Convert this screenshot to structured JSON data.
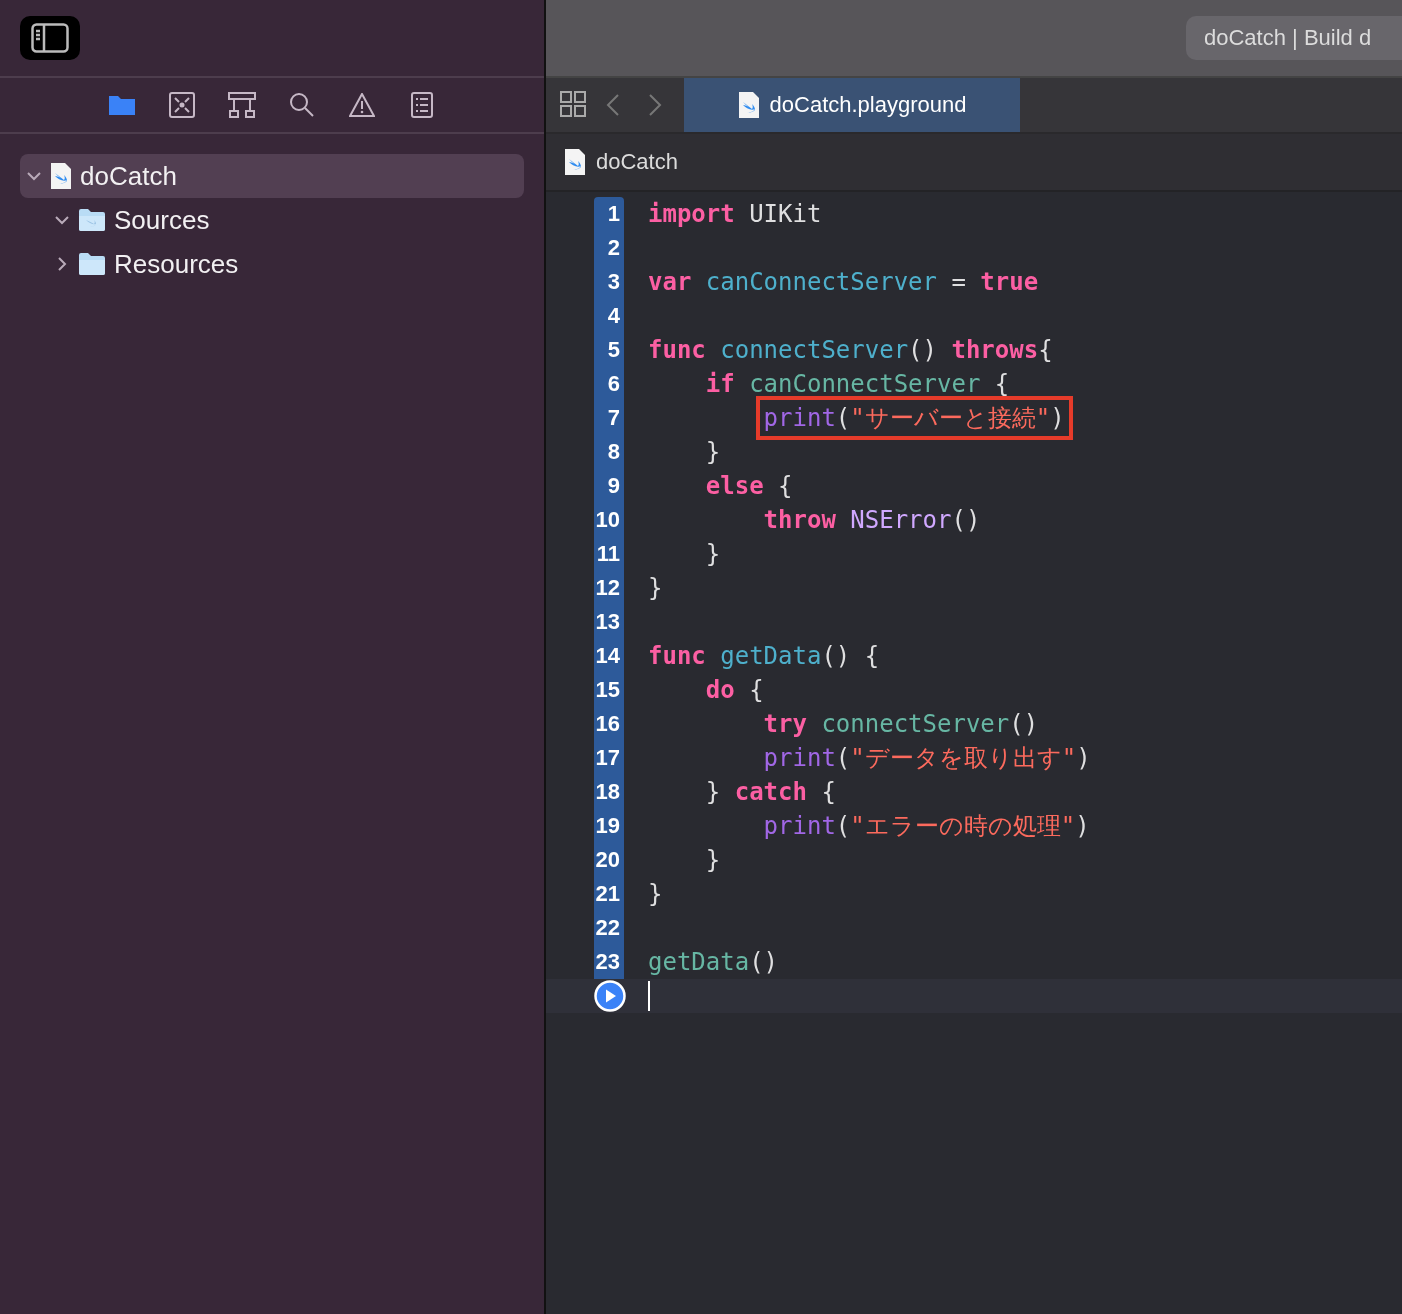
{
  "sidebar": {
    "navigator_tabs": [
      {
        "kind": "folder",
        "selected": true
      },
      {
        "kind": "source-control",
        "selected": false
      },
      {
        "kind": "hierarchy",
        "selected": false
      },
      {
        "kind": "search",
        "selected": false
      },
      {
        "kind": "warning",
        "selected": false
      },
      {
        "kind": "report",
        "selected": false
      }
    ],
    "tree": [
      {
        "label": "doCatch",
        "kind": "playground",
        "selected": true,
        "expanded": true,
        "children": [
          {
            "label": "Sources",
            "kind": "swift-folder",
            "selected": false,
            "expanded": true
          },
          {
            "label": "Resources",
            "kind": "folder",
            "selected": false,
            "expanded": false
          }
        ]
      }
    ]
  },
  "toolbar": {
    "activity_view": "doCatch | Build d"
  },
  "editor": {
    "tabs": [
      {
        "label": "doCatch.playground",
        "selected": true
      }
    ],
    "breadcrumb": [
      "doCatch"
    ],
    "lines": [
      {
        "number": "1",
        "tokens": [
          {
            "kind": "kw",
            "text": "import"
          },
          {
            "kind": "plain",
            "text": " UIKit"
          }
        ]
      },
      {
        "number": "2"
      },
      {
        "number": "3",
        "tokens": [
          {
            "kind": "kw",
            "text": "var"
          },
          {
            "kind": "decl",
            "text": " canConnectServer"
          },
          {
            "kind": "plain",
            "text": " = "
          },
          {
            "kind": "kw",
            "text": "true"
          }
        ]
      },
      {
        "number": "4"
      },
      {
        "number": "5",
        "tokens": [
          {
            "kind": "kw",
            "text": "func"
          },
          {
            "kind": "decl",
            "text": " connectServer"
          },
          {
            "kind": "plain",
            "text": "() "
          },
          {
            "kind": "kw",
            "text": "throws"
          },
          {
            "kind": "plain",
            "text": "{"
          }
        ]
      },
      {
        "number": "6",
        "tokens": [
          {
            "kind": "kw",
            "text": "    if"
          },
          {
            "kind": "ref",
            "text": " canConnectServer"
          },
          {
            "kind": "plain",
            "text": " {"
          }
        ]
      },
      {
        "number": "7",
        "highlighted": true,
        "tokens": [
          {
            "kind": "builtin",
            "text": "        print"
          },
          {
            "kind": "plain",
            "text": "("
          },
          {
            "kind": "str",
            "text": "\"サーバーと接続\""
          },
          {
            "kind": "plain",
            "text": ")"
          }
        ]
      },
      {
        "number": "8",
        "tokens": [
          {
            "kind": "plain",
            "text": "    }"
          }
        ]
      },
      {
        "number": "9",
        "tokens": [
          {
            "kind": "kw",
            "text": "    else"
          },
          {
            "kind": "plain",
            "text": " {"
          }
        ]
      },
      {
        "number": "10",
        "tokens": [
          {
            "kind": "kw",
            "text": "        throw"
          },
          {
            "kind": "type",
            "text": " NSError"
          },
          {
            "kind": "plain",
            "text": "()"
          }
        ]
      },
      {
        "number": "11",
        "tokens": [
          {
            "kind": "plain",
            "text": "    }"
          }
        ]
      },
      {
        "number": "12",
        "tokens": [
          {
            "kind": "plain",
            "text": "}"
          }
        ]
      },
      {
        "number": "13"
      },
      {
        "number": "14",
        "tokens": [
          {
            "kind": "kw",
            "text": "func"
          },
          {
            "kind": "decl",
            "text": " getData"
          },
          {
            "kind": "plain",
            "text": "() {"
          }
        ]
      },
      {
        "number": "15",
        "tokens": [
          {
            "kind": "kw",
            "text": "    do"
          },
          {
            "kind": "plain",
            "text": " {"
          }
        ]
      },
      {
        "number": "16",
        "tokens": [
          {
            "kind": "kw",
            "text": "        try"
          },
          {
            "kind": "ref",
            "text": " connectServer"
          },
          {
            "kind": "plain",
            "text": "()"
          }
        ]
      },
      {
        "number": "17",
        "tokens": [
          {
            "kind": "builtin",
            "text": "        print"
          },
          {
            "kind": "plain",
            "text": "("
          },
          {
            "kind": "str",
            "text": "\"データを取り出す\""
          },
          {
            "kind": "plain",
            "text": ")"
          }
        ]
      },
      {
        "number": "18",
        "tokens": [
          {
            "kind": "plain",
            "text": "    } "
          },
          {
            "kind": "kw",
            "text": "catch"
          },
          {
            "kind": "plain",
            "text": " {"
          }
        ]
      },
      {
        "number": "19",
        "tokens": [
          {
            "kind": "builtin",
            "text": "        print"
          },
          {
            "kind": "plain",
            "text": "("
          },
          {
            "kind": "str",
            "text": "\"エラーの時の処理\""
          },
          {
            "kind": "plain",
            "text": ")"
          }
        ]
      },
      {
        "number": "20",
        "tokens": [
          {
            "kind": "plain",
            "text": "    }"
          }
        ]
      },
      {
        "number": "21",
        "tokens": [
          {
            "kind": "plain",
            "text": "}"
          }
        ]
      },
      {
        "number": "22"
      },
      {
        "number": "23",
        "tokens": [
          {
            "kind": "ref",
            "text": "getData"
          },
          {
            "kind": "plain",
            "text": "()"
          }
        ]
      }
    ],
    "current_line": {
      "run_button": true
    }
  }
}
